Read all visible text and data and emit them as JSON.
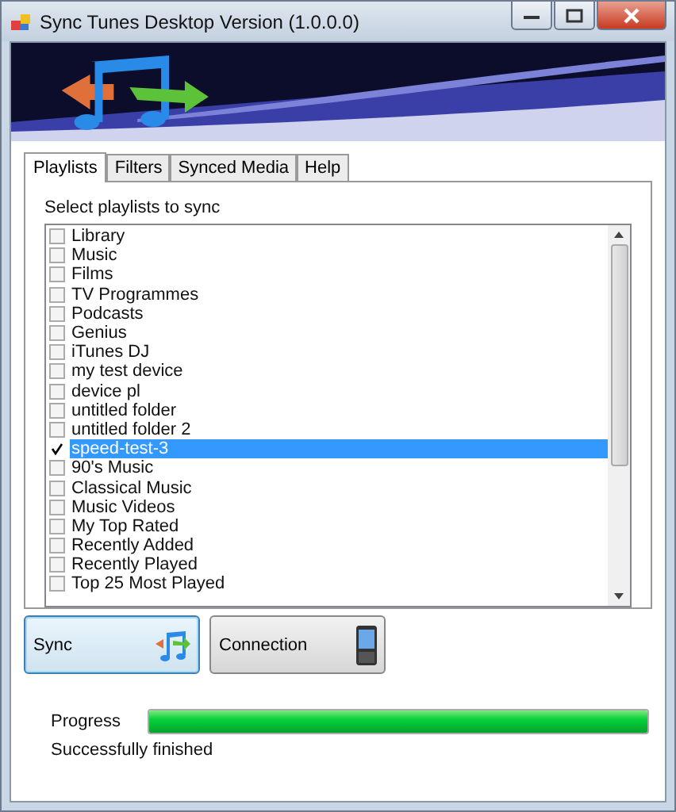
{
  "window": {
    "title": "Sync Tunes Desktop Version (1.0.0.0)"
  },
  "tabs": [
    {
      "label": "Playlists",
      "selected": true
    },
    {
      "label": "Filters",
      "selected": false
    },
    {
      "label": "Synced Media",
      "selected": false
    },
    {
      "label": "Help",
      "selected": false
    }
  ],
  "playlists": {
    "label": "Select playlists to sync",
    "items": [
      {
        "name": "Library",
        "checked": false,
        "selected": false
      },
      {
        "name": "Music",
        "checked": false,
        "selected": false
      },
      {
        "name": "Films",
        "checked": false,
        "selected": false
      },
      {
        "name": "TV Programmes",
        "checked": false,
        "selected": false
      },
      {
        "name": "Podcasts",
        "checked": false,
        "selected": false
      },
      {
        "name": "Genius",
        "checked": false,
        "selected": false
      },
      {
        "name": "iTunes DJ",
        "checked": false,
        "selected": false
      },
      {
        "name": "my test device",
        "checked": false,
        "selected": false
      },
      {
        "name": "device pl",
        "checked": false,
        "selected": false
      },
      {
        "name": "untitled folder",
        "checked": false,
        "selected": false
      },
      {
        "name": "untitled folder 2",
        "checked": false,
        "selected": false
      },
      {
        "name": "speed-test-3",
        "checked": true,
        "selected": true
      },
      {
        "name": "90's Music",
        "checked": false,
        "selected": false
      },
      {
        "name": "Classical Music",
        "checked": false,
        "selected": false
      },
      {
        "name": "Music Videos",
        "checked": false,
        "selected": false
      },
      {
        "name": "My Top Rated",
        "checked": false,
        "selected": false
      },
      {
        "name": "Recently Added",
        "checked": false,
        "selected": false
      },
      {
        "name": "Recently Played",
        "checked": false,
        "selected": false
      },
      {
        "name": "Top 25 Most Played",
        "checked": false,
        "selected": false
      }
    ]
  },
  "buttons": [
    {
      "label": "Sync",
      "kind": "sync",
      "focused": true
    },
    {
      "label": "Connection",
      "kind": "connection",
      "focused": false
    }
  ],
  "progress": {
    "label": "Progress",
    "level": 1,
    "status": "Successfully finished"
  }
}
